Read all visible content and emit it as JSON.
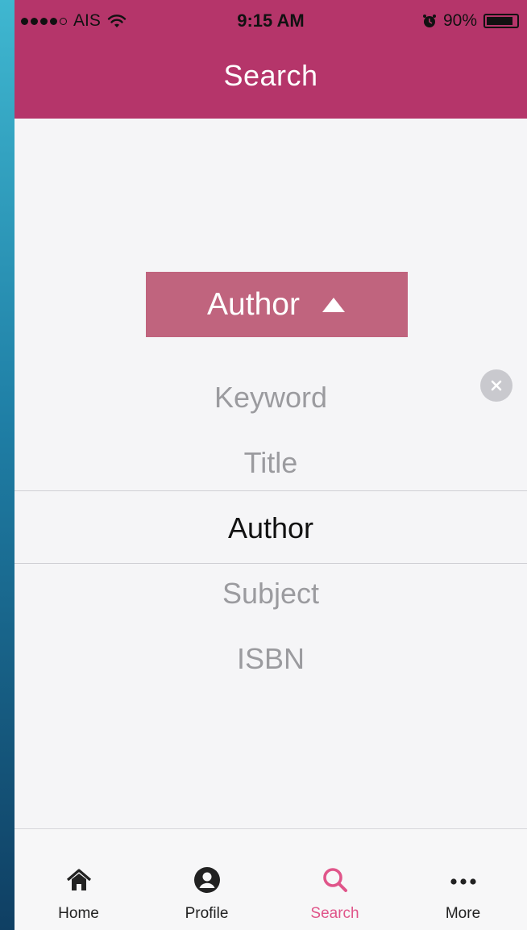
{
  "status_bar": {
    "carrier": "AIS",
    "time": "9:15 AM",
    "battery": "90%",
    "battery_level": 0.9,
    "signal_bars": 4
  },
  "nav": {
    "title": "Search"
  },
  "dropdown": {
    "selected_label": "Author"
  },
  "picker": {
    "options": [
      "Keyword",
      "Title",
      "Author",
      "Subject",
      "ISBN"
    ],
    "selected": "Author"
  },
  "tabs": [
    {
      "label": "Home",
      "icon": "home-icon"
    },
    {
      "label": "Profile",
      "icon": "profile-icon"
    },
    {
      "label": "Search",
      "icon": "search-icon",
      "active": true
    },
    {
      "label": "More",
      "icon": "more-icon"
    }
  ],
  "colors": {
    "brand": "#b5356a",
    "dropdown_bg": "#c0647e",
    "active_tab": "#e0558a"
  }
}
